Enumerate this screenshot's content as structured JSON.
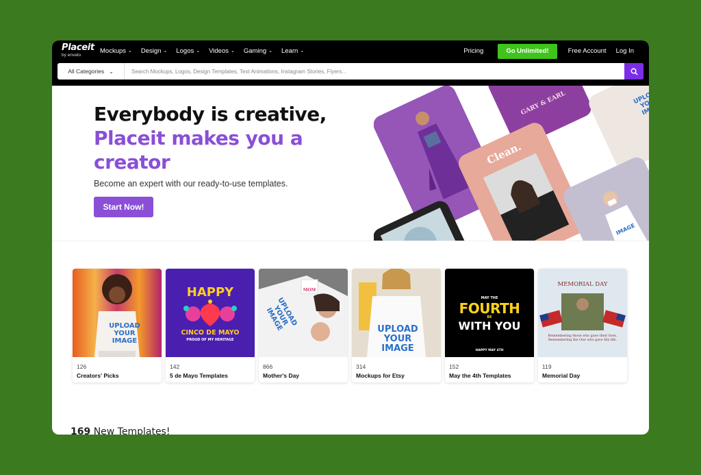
{
  "nav": {
    "logo_text": "Placeit",
    "logo_byline": "by envato",
    "menu": [
      {
        "label": "Mockups"
      },
      {
        "label": "Design"
      },
      {
        "label": "Logos"
      },
      {
        "label": "Videos"
      },
      {
        "label": "Gaming"
      },
      {
        "label": "Learn"
      }
    ],
    "pricing": "Pricing",
    "cta": "Go Unlimited!",
    "free_account": "Free Account",
    "login": "Log In"
  },
  "search": {
    "category": "All Categories",
    "placeholder": "Search Mockups, Logos, Design Templates, Text Animations, Instagram Stories, Flyers..."
  },
  "hero": {
    "line1": "Everybody is creative,",
    "line2": "Placeit makes you a",
    "line3": "creator",
    "subtitle": "Become an expert with our ready-to-use templates.",
    "button": "Start Now!",
    "tile_texts": {
      "gary": "GARY & EARL",
      "clean": "Clean.",
      "shirt_upload": "UPLOAD YOUR IMAGE"
    }
  },
  "categories": [
    {
      "count": "126",
      "name": "Creators' Picks",
      "thumb_text": "UPLOAD YOUR IMAGE"
    },
    {
      "count": "142",
      "name": "5 de Mayo Templates",
      "thumb_text": "HAPPY",
      "thumb_text2": "CINCO DE MAYO",
      "thumb_text3": "PROUD OF MY HERITAGE"
    },
    {
      "count": "866",
      "name": "Mother's Day",
      "thumb_text": "UPLOAD YOUR IMAGE",
      "thumb_text2": "MOM"
    },
    {
      "count": "314",
      "name": "Mockups for Etsy",
      "thumb_text": "UPLOAD YOUR IMAGE"
    },
    {
      "count": "152",
      "name": "May the 4th Templates",
      "thumb_text": "MAY THE",
      "thumb_text2": "FOURTH",
      "thumb_text3": "BE",
      "thumb_text4": "WITH YOU",
      "thumb_text5": "HAPPY MAY 4TH"
    },
    {
      "count": "119",
      "name": "Memorial Day",
      "thumb_text": "MEMORIAL DAY",
      "thumb_text2": "Remembering those who gave their lives. Remembering the One who gave His life."
    }
  ],
  "new_templates": {
    "count": "169",
    "label": "New Templates!"
  },
  "colors": {
    "background": "#3b7a1f",
    "brand_purple": "#8a4fd6",
    "cta_green": "#3fc41c",
    "search_button": "#7b2ee5",
    "nav_bg": "#000000"
  }
}
